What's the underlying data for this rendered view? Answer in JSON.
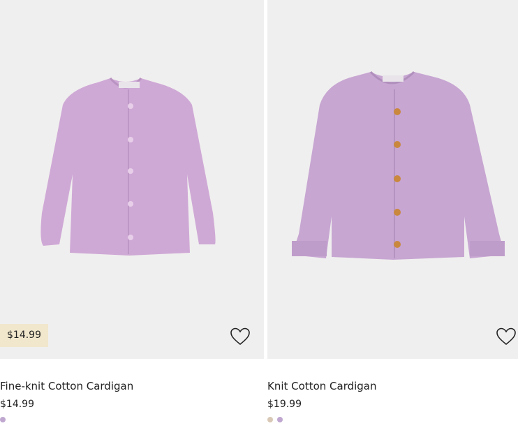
{
  "products": [
    {
      "name": "Fine-knit Cotton Cardigan",
      "price": "$14.99",
      "badge_price": "$14.99",
      "image_icon": "cardigan-image",
      "favorite_icon": "heart-outline-icon",
      "swatches": [
        {
          "color": "#bfa7d0",
          "label": "lilac"
        }
      ],
      "colors": {
        "image_bg": "#f0efef",
        "garment": "#cfa9d6",
        "buttons": "#e8cfe9",
        "badge_bg": "#f1e7cc"
      }
    },
    {
      "name": "Knit Cotton Cardigan",
      "price": "$19.99",
      "image_icon": "cardigan-image",
      "favorite_icon": "heart-outline-icon",
      "swatches": [
        {
          "color": "#d8c8b5",
          "label": "beige"
        },
        {
          "color": "#bfa7d0",
          "label": "lilac"
        }
      ],
      "colors": {
        "image_bg": "#f0efef",
        "garment": "#c7a6d2",
        "buttons": "#c9883e"
      }
    }
  ]
}
